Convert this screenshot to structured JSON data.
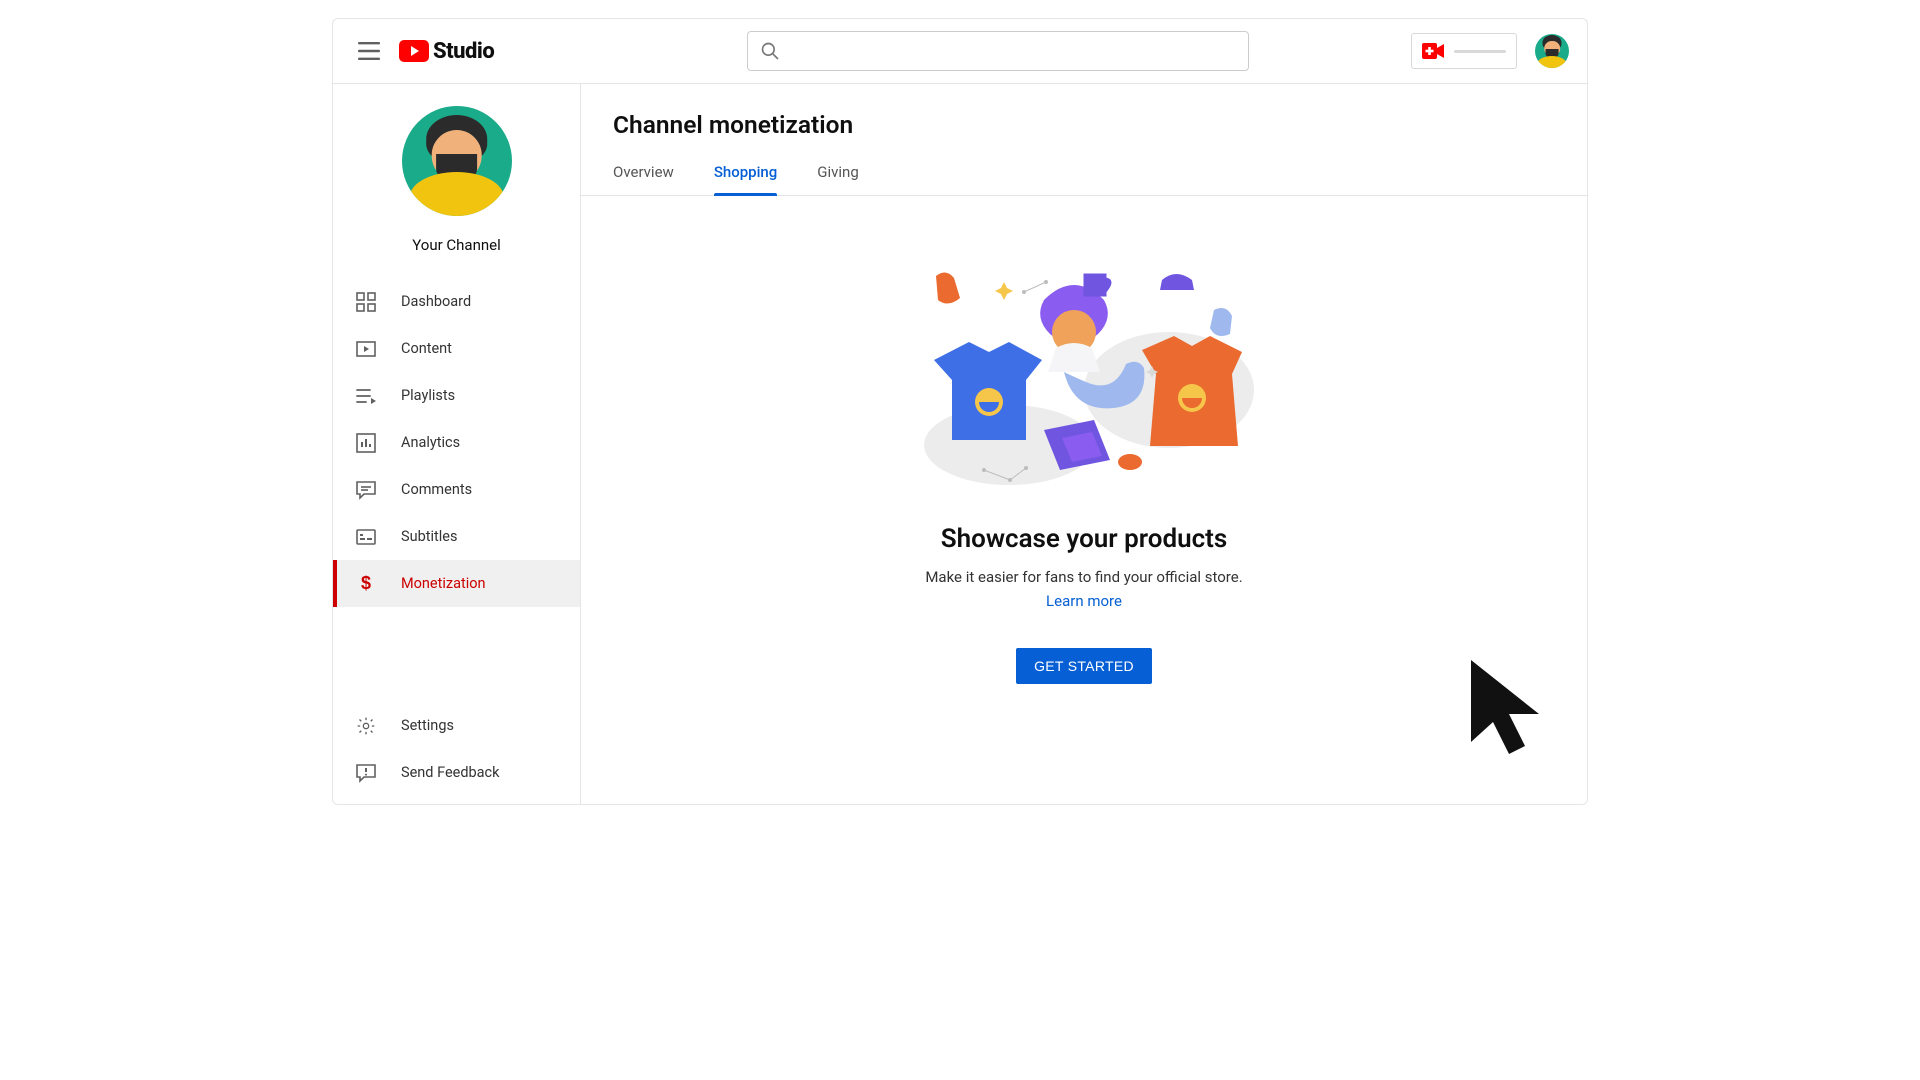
{
  "header": {
    "logo_text": "Studio",
    "search_placeholder": ""
  },
  "sidebar": {
    "channel_name": "Your Channel",
    "items": [
      {
        "label": "Dashboard"
      },
      {
        "label": "Content"
      },
      {
        "label": "Playlists"
      },
      {
        "label": "Analytics"
      },
      {
        "label": "Comments"
      },
      {
        "label": "Subtitles"
      },
      {
        "label": "Monetization"
      }
    ],
    "bottom": [
      {
        "label": "Settings"
      },
      {
        "label": "Send Feedback"
      }
    ]
  },
  "main": {
    "title": "Channel monetization",
    "tabs": [
      {
        "label": "Overview"
      },
      {
        "label": "Shopping"
      },
      {
        "label": "Giving"
      }
    ],
    "promo": {
      "headline": "Showcase your products",
      "subtext": "Make it easier for fans to find your official store.",
      "learn_more": "Learn more",
      "cta": "GET STARTED"
    }
  }
}
